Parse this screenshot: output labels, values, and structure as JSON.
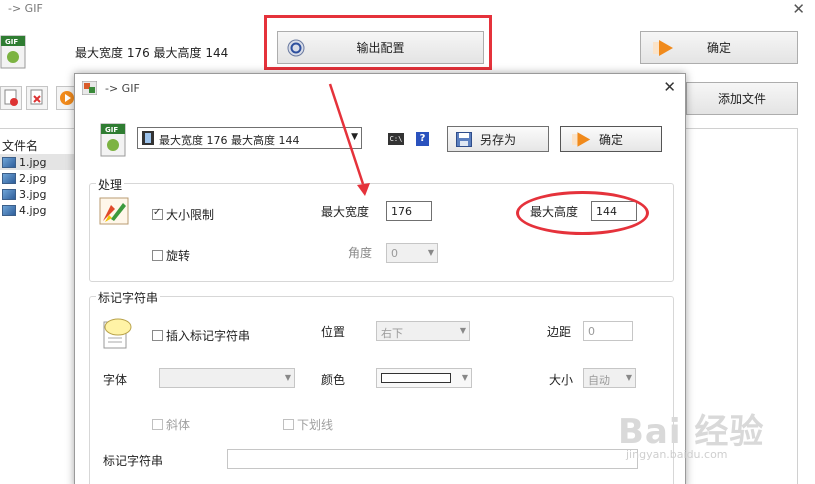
{
  "outer": {
    "title": "-> GIF",
    "close_glyph": "✕",
    "dims_text": "最大宽度 176 最大高度 144",
    "output_config_label": "输出配置",
    "ok_label": "确定",
    "add_file_label": "添加文件",
    "file_list": {
      "header": "文件名",
      "items": [
        "1.jpg",
        "2.jpg",
        "3.jpg",
        "4.jpg"
      ]
    }
  },
  "dialog": {
    "title": "-> GIF",
    "close_glyph": "✕",
    "preset_value": "最大宽度 176 最大高度 144",
    "cmd_icon_text": "C:\\",
    "help_icon_text": "?",
    "save_as_label": "另存为",
    "ok_label": "确定",
    "process": {
      "group_label": "处理",
      "size_limit_label": "大小限制",
      "size_limit_checked": true,
      "max_width_label": "最大宽度",
      "max_width_value": "176",
      "max_height_label": "最大高度",
      "max_height_value": "144",
      "rotate_label": "旋转",
      "rotate_checked": false,
      "angle_label": "角度",
      "angle_value": "0"
    },
    "mark": {
      "group_label": "标记字符串",
      "insert_label": "插入标记字符串",
      "insert_checked": false,
      "position_label": "位置",
      "position_value": "右下",
      "margin_label": "边距",
      "margin_value": "0",
      "font_label": "字体",
      "font_value": "",
      "color_label": "颜色",
      "size_label": "大小",
      "size_value": "自动",
      "italic_label": "斜体",
      "underline_label": "下划线",
      "mark_string_label": "标记字符串",
      "mark_string_value": ""
    }
  },
  "watermark": {
    "text": "Bai 经验",
    "sub": "jingyan.baidu.com"
  },
  "colors": {
    "annotation_red": "#e5323b",
    "accent_orange": "#f08a1c"
  },
  "icons": [
    "gif-file-icon",
    "output-config-icon",
    "arrow-right-icon",
    "save-icon",
    "paint-brush-icon",
    "speech-note-icon",
    "help-icon",
    "cmd-icon"
  ]
}
